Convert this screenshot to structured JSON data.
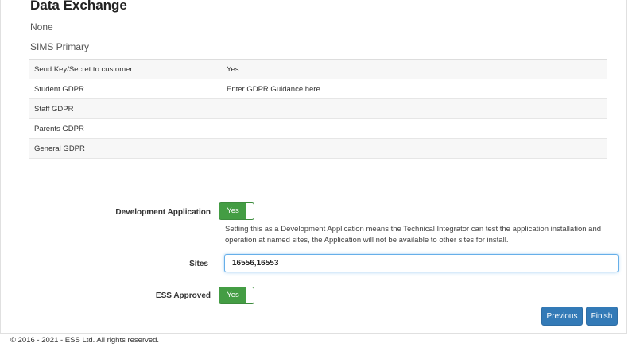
{
  "header": {
    "title": "Data Exchange",
    "line1": "None",
    "line2": "SIMS Primary"
  },
  "table": {
    "rows": [
      {
        "key": "Send Key/Secret to customer",
        "value": "Yes"
      },
      {
        "key": "Student GDPR",
        "value": "Enter GDPR Guidance here"
      },
      {
        "key": "Staff GDPR",
        "value": ""
      },
      {
        "key": "Parents GDPR",
        "value": ""
      },
      {
        "key": "General GDPR",
        "value": ""
      }
    ]
  },
  "form": {
    "dev_app": {
      "label": "Development Application",
      "toggle_label": "Yes",
      "help": "Setting this as a Development Application means the Technical Integrator can test the application installation and operation at named sites, the Application will not be available to other sites for install."
    },
    "sites": {
      "label": "Sites",
      "value": "16556,16553"
    },
    "ess_approved": {
      "label": "ESS Approved",
      "toggle_label": "Yes"
    }
  },
  "buttons": {
    "previous": "Previous",
    "finish": "Finish"
  },
  "footer": {
    "copyright": "© 2016 - 2021 - ESS Ltd. All rights reserved."
  },
  "colors": {
    "toggle_on": "#449d44",
    "primary": "#337ab7",
    "focus": "#66afe9"
  }
}
